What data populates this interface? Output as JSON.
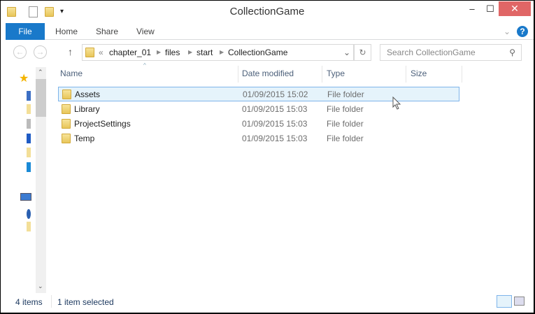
{
  "window": {
    "title": "CollectionGame",
    "minimize": "–",
    "maximize": "☐",
    "close": "✕"
  },
  "ribbon": {
    "tabs": [
      "File",
      "Home",
      "Share",
      "View"
    ],
    "help": "?",
    "expand": "⌄"
  },
  "address": {
    "back": "←",
    "forward": "→",
    "up": "↑",
    "prefix": "«",
    "crumbs": [
      "chapter_01",
      "files",
      "start",
      "CollectionGame"
    ],
    "sep": "▶",
    "dropdown": "⌄",
    "refresh": "↻"
  },
  "search": {
    "placeholder": "Search CollectionGame",
    "icon": "⚲"
  },
  "columns": [
    "Name",
    "Date modified",
    "Type",
    "Size"
  ],
  "files": [
    {
      "name": "Assets",
      "date": "01/09/2015 15:02",
      "type": "File folder",
      "selected": true
    },
    {
      "name": "Library",
      "date": "01/09/2015 15:03",
      "type": "File folder"
    },
    {
      "name": "ProjectSettings",
      "date": "01/09/2015 15:03",
      "type": "File folder"
    },
    {
      "name": "Temp",
      "date": "01/09/2015 15:03",
      "type": "File folder"
    }
  ],
  "status": {
    "count": "4 items",
    "selection": "1 item selected"
  }
}
